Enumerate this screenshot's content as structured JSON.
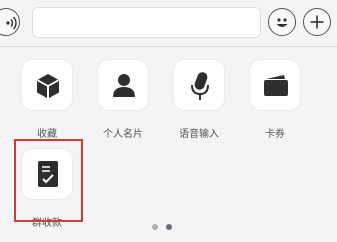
{
  "icons": {
    "voice": "voice-icon",
    "emoji": "emoji-icon",
    "plus": "plus-icon",
    "favorites": "cube-icon",
    "contact_card": "person-icon",
    "voice_input": "microphone-icon",
    "coupon": "card-icon",
    "group_collect": "clipboard-check-icon"
  },
  "colors": {
    "highlight_border": "#d23a3a",
    "icon_dark": "#2e2e30"
  },
  "panel": {
    "items": [
      {
        "label": "收藏",
        "icon": "cube-icon"
      },
      {
        "label": "个人名片",
        "icon": "person-icon"
      },
      {
        "label": "语音输入",
        "icon": "microphone-icon"
      },
      {
        "label": "卡券",
        "icon": "card-icon"
      },
      {
        "label": "群收款",
        "icon": "clipboard-check-icon",
        "highlighted": true
      }
    ],
    "page_indicator": {
      "pages": 2,
      "current": 2
    }
  }
}
